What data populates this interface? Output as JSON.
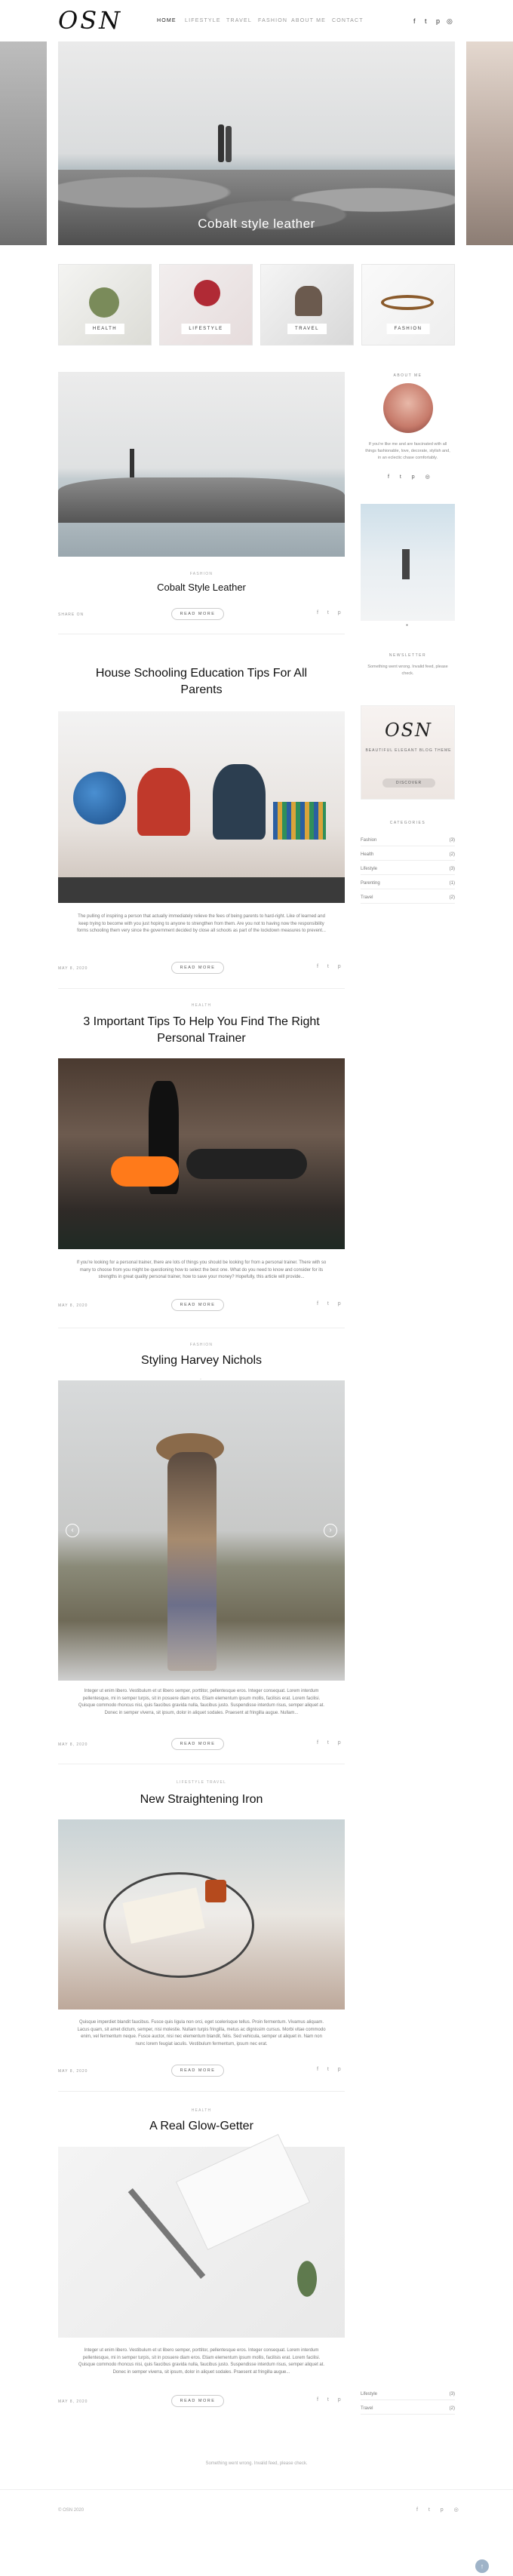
{
  "header": {
    "logo": "OSN",
    "nav": [
      "HOME",
      "LIFESTYLE",
      "TRAVEL",
      "FASHION",
      "ABOUT ME",
      "CONTACT"
    ],
    "social_icons": [
      "facebook-icon",
      "twitter-icon",
      "pinterest-icon",
      "instagram-icon"
    ]
  },
  "hero": {
    "title": "Cobalt style leather"
  },
  "categories": [
    {
      "label": "HEALTH"
    },
    {
      "label": "LIFESTYLE"
    },
    {
      "label": "TRAVEL"
    },
    {
      "label": "FASHION"
    }
  ],
  "featured": {
    "category": "FASHION",
    "title": "Cobalt Style Leather",
    "share_label": "SHARE ON",
    "read_more": "READ MORE"
  },
  "posts": [
    {
      "category": "",
      "title_line1": "House Schooling Education Tips For All",
      "title_line2": "Parents",
      "excerpt": "The pulling of inspiring a person that actually immediately relieve the fees of being parents to hard-right. Like of learned and keep trying to become with you just hoping to anyone to strengthen from them. Are you not to having now the responsibility forms schooling them very since the government decided by close all schools as part of the lockdown measures to prevent...",
      "date": "MAY 8, 2020",
      "read_more": "READ MORE"
    },
    {
      "category": "HEALTH",
      "title_line1": "3 Important Tips To Help You Find The Right",
      "title_line2": "Personal Trainer",
      "excerpt": "If you're looking for a personal trainer, there are lots of things you should be looking for from a personal trainer. There with so many to choose from you might be questioning how to select the best one. What do you need to know and consider for its strengths in great quality personal trainer, how to save your money? Hopefully, this article will provide...",
      "date": "MAY 8, 2020",
      "read_more": "READ MORE"
    },
    {
      "category": "FASHION",
      "title_line1": "Styling Harvey Nichols",
      "title_line2": "",
      "excerpt": "Integer ut enim libero. Vestibulum et ut libero semper, porttitor, pellentesque eros. Integer consequat. Lorem interdum pellentesque, mi in semper turpis, sit in posuere diam eros. Etiam elementum ipsum mollis, facilisis erat. Lorem facilisi. Quisque commodo rhoncus nisi, quis faucibus gravida nulla, faucibus justo. Suspendisse interdum risus, semper aliquet at. Donec in semper viverra, sit ipsum, dolor in aliquet sodales. Praesent at fringilla augue. Nullam...",
      "date": "MAY 8, 2020",
      "read_more": "READ MORE"
    },
    {
      "category": "LIFESTYLE    TRAVEL",
      "title_line1": "New Straightening Iron",
      "title_line2": "",
      "excerpt": "Quisque imperdiet blandit faucibus. Fusce quis ligula non orci, eget scelerisque tellus. Proin fermentum. Vivamus aliquam. Lacus quam, sit amet dictum, semper, nisi molestie. Nullam turpis fringilla, metus ac dignissim cursus. Morbi vitae commodo enim, vel fermentum neque. Fusce auctor, nisi nec elementum blandit, felis. Sed vehicula, semper ut aliquet in. Nam non nunc lorem feugiat iaculis. Vestibulum fermentum, ipsum nec erat.",
      "date": "MAY 8, 2020",
      "read_more": "READ MORE"
    },
    {
      "category": "HEALTH",
      "title_line1": "A Real Glow-Getter",
      "title_line2": "",
      "excerpt": "Integer ut enim libero. Vestibulum et ut libero semper, porttitor, pellentesque eros. Integer consequat. Lorem interdum pellentesque, mi in semper turpis, sit in posuere diam eros. Etiam elementum ipsum mollis, facilisis erat. Lorem facilisi. Quisque commodo rhoncus nisi, quis faucibus gravida nulla, faucibus justo. Suspendisse interdum risus, semper aliquet at. Donec in semper viverra, sit ipsum, dolor in aliquet sodales. Praesent at fringilla augue...",
      "date": "MAY 8, 2020",
      "read_more": "READ MORE"
    }
  ],
  "sidebar": {
    "about_heading": "ABOUT ME",
    "about_text": "If you're like me and are fascinated with all things fashionable, love, decorate, stylish and, in an eclectic chase comfortably.",
    "newsletter_heading": "NEWSLETTER",
    "newsletter_text": "Something went wrong. Invalid feed, please check.",
    "promo_logo": "OSN",
    "promo_text": "BEAUTIFUL ELEGANT BLOG THEME",
    "promo_button": "DISCOVER",
    "categories_heading": "CATEGORIES",
    "categories": [
      {
        "name": "Fashion",
        "count": "(3)"
      },
      {
        "name": "Health",
        "count": "(2)"
      },
      {
        "name": "Lifestyle",
        "count": "(3)"
      },
      {
        "name": "Parenting",
        "count": "(1)"
      },
      {
        "name": "Travel",
        "count": "(2)"
      }
    ],
    "bottom_links": [
      {
        "name": "Lifestyle",
        "count": "(3)"
      },
      {
        "name": "Travel",
        "count": "(2)"
      }
    ]
  },
  "footer": {
    "notice": "Something went wrong. Invalid feed, please check.",
    "copyright": "© OSN 2020",
    "social_icons": [
      "facebook-icon",
      "twitter-icon",
      "pinterest-icon",
      "instagram-icon"
    ]
  }
}
